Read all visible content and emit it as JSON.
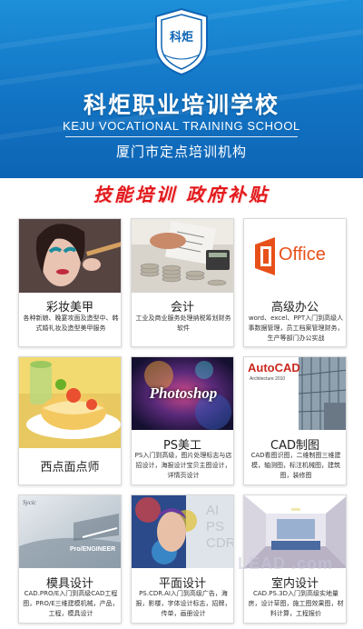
{
  "header": {
    "logo_text": "科炬",
    "school_name_cn": "科炬职业培训学校",
    "school_name_en": "KEJU VOCATIONAL TRAINING SCHOOL",
    "tagline": "厦门市定点培训机构"
  },
  "slogan": "技能培训 政府补贴",
  "courses": [
    {
      "title": "彩妆美甲",
      "desc": "各种新娘、晚宴攻面及造型中、韩式婚礼妆及造型美甲服务",
      "image": "makeup-photo"
    },
    {
      "title": "会计",
      "desc": "工业及商业服务处理纳税筹划财务软件",
      "image": "accounting-photo"
    },
    {
      "title": "高级办公",
      "desc": "word、excel、PPT入门到高级人事数据管理，员工档案管理财务，生产等部门办公实战",
      "image": "office-logo",
      "logo_text": "Office"
    },
    {
      "title": "西点面点师",
      "desc": "",
      "image": "pastry-photo"
    },
    {
      "title": "PS美工",
      "desc": "PS入门到高级，图片处理标志与店招设计，海报设计宝贝主图设计，详情页设计",
      "image": "photoshop-splash",
      "logo_text": "Photoshop"
    },
    {
      "title": "CAD制图",
      "desc": "CAD看图识图，二维制图三维建模，轴测图，标注机械图，建筑图，装修图",
      "image": "autocad-splash",
      "logo_text": "AutoCAD",
      "sub_text": "Architecture 2010"
    },
    {
      "title": "模具设计",
      "desc": "CAD.PRO/E入门到高级CAD工程图，PRO/E三维建模机械，产品，工程，模具设计",
      "image": "proengineer-splash",
      "logo_text": "Pro/ENGINEER",
      "corner_text": "Sycic"
    },
    {
      "title": "平面设计",
      "desc": "PS.CDR.AI入门到高级广告，海报，影楼，字体设计标志，招牌，传单，画册设计",
      "image": "design-splash",
      "overlay_text": "AI PS CDR"
    },
    {
      "title": "室内设计",
      "desc": "CAD.PS.3D入门到高级实地量房，设计草图，施工图效果图，材料计算，工程报价",
      "image": "interior-photo"
    }
  ],
  "watermark": "LEAD .com"
}
